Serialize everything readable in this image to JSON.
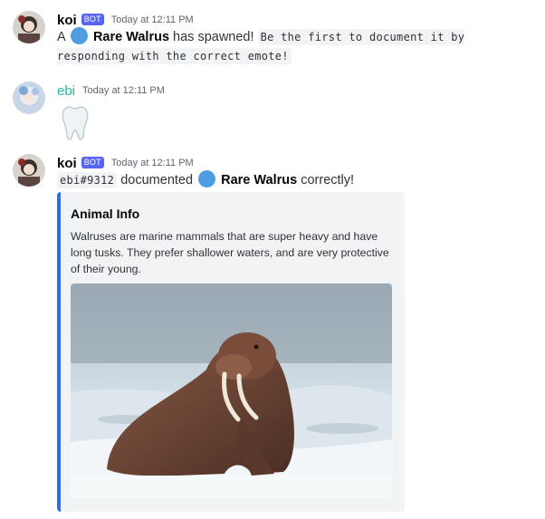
{
  "messages": [
    {
      "username": "koi",
      "bot_tag": "BOT",
      "timestamp": "Today at 12:11 PM",
      "parts": {
        "prefix": "A",
        "creature": "Rare Walrus",
        "middle": "has spawned!",
        "code": "Be the first to document it by responding with the correct emote!"
      }
    },
    {
      "username": "ebi",
      "timestamp": "Today at 12:11 PM",
      "reaction_emoji": "tooth-emoji"
    },
    {
      "username": "koi",
      "bot_tag": "BOT",
      "timestamp": "Today at 12:11 PM",
      "parts": {
        "user_code": "ebi#9312",
        "middle": "documented",
        "creature": "Rare Walrus",
        "suffix": "correctly!"
      },
      "embed": {
        "title": "Animal Info",
        "description": "Walruses are marine mammals that are super heavy and have long tusks. They prefer shallower waters, and are very protective of their young."
      }
    }
  ],
  "colors": {
    "bot_tag": "#5865f2",
    "ebi_name": "#1abc9c",
    "embed_border": "#2f6ee0",
    "globe": "#4d9de0"
  }
}
